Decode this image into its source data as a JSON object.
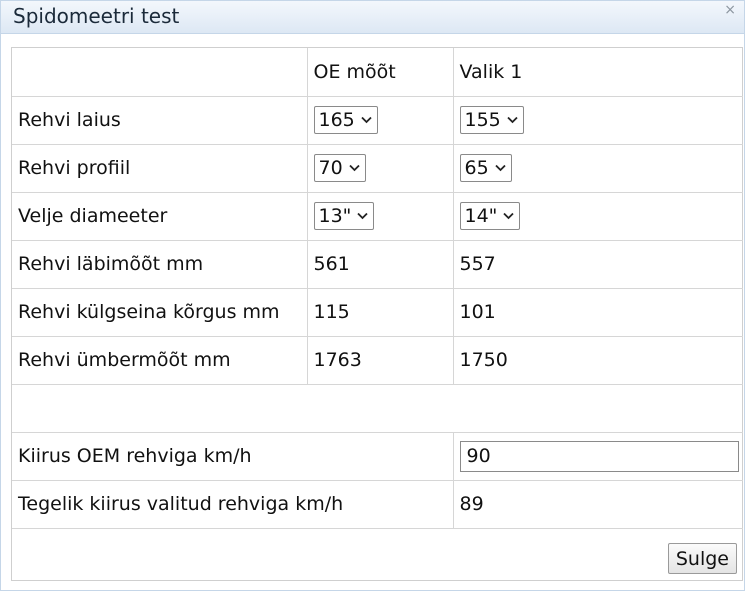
{
  "dialog": {
    "title": "Spidomeetri test",
    "close_glyph": "×",
    "close_icon": "close-icon"
  },
  "table": {
    "headers": [
      "",
      "OE mõõt",
      "Valik 1"
    ],
    "select_rows": [
      {
        "label": "Rehvi laius",
        "oe": "165",
        "valik": "155"
      },
      {
        "label": "Rehvi profiil",
        "oe": "70",
        "valik": "65"
      },
      {
        "label": "Velje diameeter",
        "oe": "13\"",
        "valik": "14\""
      }
    ],
    "value_rows": [
      {
        "label": "Rehvi läbimõõt mm",
        "oe": "561",
        "valik": "557"
      },
      {
        "label": "Rehvi külgseina kõrgus mm",
        "oe": "115",
        "valik": "101"
      },
      {
        "label": "Rehvi ümbermõõt mm",
        "oe": "1763",
        "valik": "1750"
      }
    ]
  },
  "speed": {
    "oem_label": "Kiirus OEM rehviga km/h",
    "oem_value": "90",
    "actual_label": "Tegelik kiirus valitud rehviga km/h",
    "actual_value": "89"
  },
  "buttons": {
    "close_label": "Sulge"
  },
  "colors": {
    "titlebar_top": "#f3f7fc",
    "titlebar_bottom": "#dde8f4",
    "border": "#d6d6d6"
  }
}
